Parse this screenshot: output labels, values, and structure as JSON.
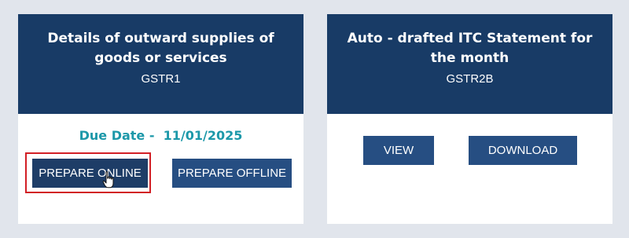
{
  "cards": [
    {
      "title": "Details of outward supplies of goods or services",
      "form": "GSTR1",
      "due_date_label": "Due Date -",
      "due_date_value": "11/01/2025",
      "buttons": {
        "prepare_online": "PREPARE ONLINE",
        "prepare_offline": "PREPARE OFFLINE"
      }
    },
    {
      "title": "Auto - drafted ITC Statement for the month",
      "form": "GSTR2B",
      "buttons": {
        "view": "VIEW",
        "download": "DOWNLOAD"
      }
    }
  ],
  "colors": {
    "page_background": "#e1e5ec",
    "header_background": "#183b66",
    "button_background": "#264e82",
    "due_date_text": "#1c98a9",
    "highlight_border": "#d21f25"
  },
  "icons": {
    "cursor": "hand-pointer-icon"
  }
}
